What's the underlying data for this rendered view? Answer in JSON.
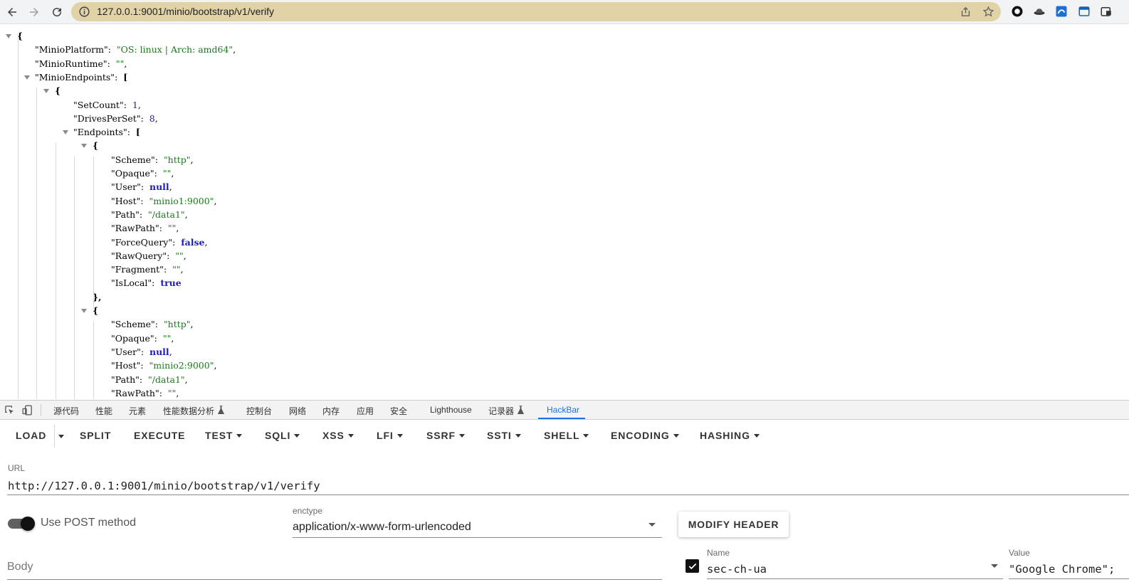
{
  "browser": {
    "url": "127.0.0.1:9001/minio/bootstrap/v1/verify",
    "extensions": [
      "circle-extension-icon",
      "hat-extension-icon",
      "blue-extension-icon",
      "window-extension-icon",
      "tab-extension-icon"
    ]
  },
  "json": {
    "lines": [
      {
        "t": [
          [
            "{",
            "jbr"
          ]
        ]
      },
      {
        "t": [
          [
            "\"MinioPlatform\"",
            "jkey"
          ],
          [
            ":  ",
            "jpunc"
          ],
          [
            "\"OS: linux | Arch: amd64\"",
            "jstr"
          ],
          [
            ",",
            "jpunc"
          ]
        ]
      },
      {
        "t": [
          [
            "\"MinioRuntime\"",
            "jkey"
          ],
          [
            ":  ",
            "jpunc"
          ],
          [
            "\"\"",
            "jstr"
          ],
          [
            ",",
            "jpunc"
          ]
        ]
      },
      {
        "t": [
          [
            "\"MinioEndpoints\"",
            "jkey"
          ],
          [
            ":  ",
            "jpunc"
          ],
          [
            "[",
            "jbr"
          ]
        ]
      },
      {
        "t": [
          [
            "{",
            "jbr"
          ]
        ]
      },
      {
        "t": [
          [
            "\"SetCount\"",
            "jkey"
          ],
          [
            ":  ",
            "jpunc"
          ],
          [
            "1",
            "jnum"
          ],
          [
            ",",
            "jpunc"
          ]
        ]
      },
      {
        "t": [
          [
            "\"DrivesPerSet\"",
            "jkey"
          ],
          [
            ":  ",
            "jpunc"
          ],
          [
            "8",
            "jnum"
          ],
          [
            ",",
            "jpunc"
          ]
        ]
      },
      {
        "t": [
          [
            "\"Endpoints\"",
            "jkey"
          ],
          [
            ":  ",
            "jpunc"
          ],
          [
            "[",
            "jbr"
          ]
        ]
      },
      {
        "t": [
          [
            "{",
            "jbr"
          ]
        ]
      },
      {
        "t": [
          [
            "\"Scheme\"",
            "jkey"
          ],
          [
            ":  ",
            "jpunc"
          ],
          [
            "\"http\"",
            "jstr"
          ],
          [
            ",",
            "jpunc"
          ]
        ]
      },
      {
        "t": [
          [
            "\"Opaque\"",
            "jkey"
          ],
          [
            ":  ",
            "jpunc"
          ],
          [
            "\"\"",
            "jstr"
          ],
          [
            ",",
            "jpunc"
          ]
        ]
      },
      {
        "t": [
          [
            "\"User\"",
            "jkey"
          ],
          [
            ":  ",
            "jpunc"
          ],
          [
            "null",
            "jkw"
          ],
          [
            ",",
            "jpunc"
          ]
        ]
      },
      {
        "t": [
          [
            "\"Host\"",
            "jkey"
          ],
          [
            ":  ",
            "jpunc"
          ],
          [
            "\"minio1:9000\"",
            "jstr"
          ],
          [
            ",",
            "jpunc"
          ]
        ]
      },
      {
        "t": [
          [
            "\"Path\"",
            "jkey"
          ],
          [
            ":  ",
            "jpunc"
          ],
          [
            "\"/data1\"",
            "jstr"
          ],
          [
            ",",
            "jpunc"
          ]
        ]
      },
      {
        "t": [
          [
            "\"RawPath\"",
            "jkey"
          ],
          [
            ":  ",
            "jpunc"
          ],
          [
            "\"\"",
            "jstr"
          ],
          [
            ",",
            "jpunc"
          ]
        ]
      },
      {
        "t": [
          [
            "\"ForceQuery\"",
            "jkey"
          ],
          [
            ":  ",
            "jpunc"
          ],
          [
            "false",
            "jkw"
          ],
          [
            ",",
            "jpunc"
          ]
        ]
      },
      {
        "t": [
          [
            "\"RawQuery\"",
            "jkey"
          ],
          [
            ":  ",
            "jpunc"
          ],
          [
            "\"\"",
            "jstr"
          ],
          [
            ",",
            "jpunc"
          ]
        ]
      },
      {
        "t": [
          [
            "\"Fragment\"",
            "jkey"
          ],
          [
            ":  ",
            "jpunc"
          ],
          [
            "\"\"",
            "jstr"
          ],
          [
            ",",
            "jpunc"
          ]
        ]
      },
      {
        "t": [
          [
            "\"IsLocal\"",
            "jkey"
          ],
          [
            ":  ",
            "jpunc"
          ],
          [
            "true",
            "jkw"
          ]
        ]
      },
      {
        "t": [
          [
            "},",
            "jbr"
          ]
        ]
      },
      {
        "t": [
          [
            "{",
            "jbr"
          ]
        ]
      },
      {
        "t": [
          [
            "\"Scheme\"",
            "jkey"
          ],
          [
            ":  ",
            "jpunc"
          ],
          [
            "\"http\"",
            "jstr"
          ],
          [
            ",",
            "jpunc"
          ]
        ]
      },
      {
        "t": [
          [
            "\"Opaque\"",
            "jkey"
          ],
          [
            ":  ",
            "jpunc"
          ],
          [
            "\"\"",
            "jstr"
          ],
          [
            ",",
            "jpunc"
          ]
        ]
      },
      {
        "t": [
          [
            "\"User\"",
            "jkey"
          ],
          [
            ":  ",
            "jpunc"
          ],
          [
            "null",
            "jkw"
          ],
          [
            ",",
            "jpunc"
          ]
        ]
      },
      {
        "t": [
          [
            "\"Host\"",
            "jkey"
          ],
          [
            ":  ",
            "jpunc"
          ],
          [
            "\"minio2:9000\"",
            "jstr"
          ],
          [
            ",",
            "jpunc"
          ]
        ]
      },
      {
        "t": [
          [
            "\"Path\"",
            "jkey"
          ],
          [
            ":  ",
            "jpunc"
          ],
          [
            "\"/data1\"",
            "jstr"
          ],
          [
            ",",
            "jpunc"
          ]
        ]
      },
      {
        "t": [
          [
            "\"RawPath\"",
            "jkey"
          ],
          [
            ":  ",
            "jpunc"
          ],
          [
            "\"\"",
            "jstr"
          ],
          [
            ",",
            "jpunc"
          ]
        ]
      }
    ]
  },
  "devtools": {
    "tabs": [
      "源代码",
      "性能",
      "元素",
      "性能数据分析",
      "控制台",
      "网络",
      "内存",
      "应用",
      "安全",
      "Lighthouse",
      "记录器",
      "HackBar"
    ],
    "active_tab": "HackBar"
  },
  "hackbar": {
    "buttons": [
      "LOAD",
      "SPLIT",
      "EXECUTE",
      "TEST",
      "SQLI",
      "XSS",
      "LFI",
      "SSRF",
      "SSTI",
      "SHELL",
      "ENCODING",
      "HASHING"
    ],
    "url_label": "URL",
    "url_value": "http://127.0.0.1:9001/minio/bootstrap/v1/verify",
    "post_label": "Use POST method",
    "enctype_label": "enctype",
    "enctype_value": "application/x-www-form-urlencoded",
    "modify_header": "MODIFY HEADER",
    "body_placeholder": "Body",
    "header_name_label": "Name",
    "header_name_value": "sec-ch-ua",
    "header_value_label": "Value",
    "header_value_value": "\"Google Chrome\";"
  }
}
